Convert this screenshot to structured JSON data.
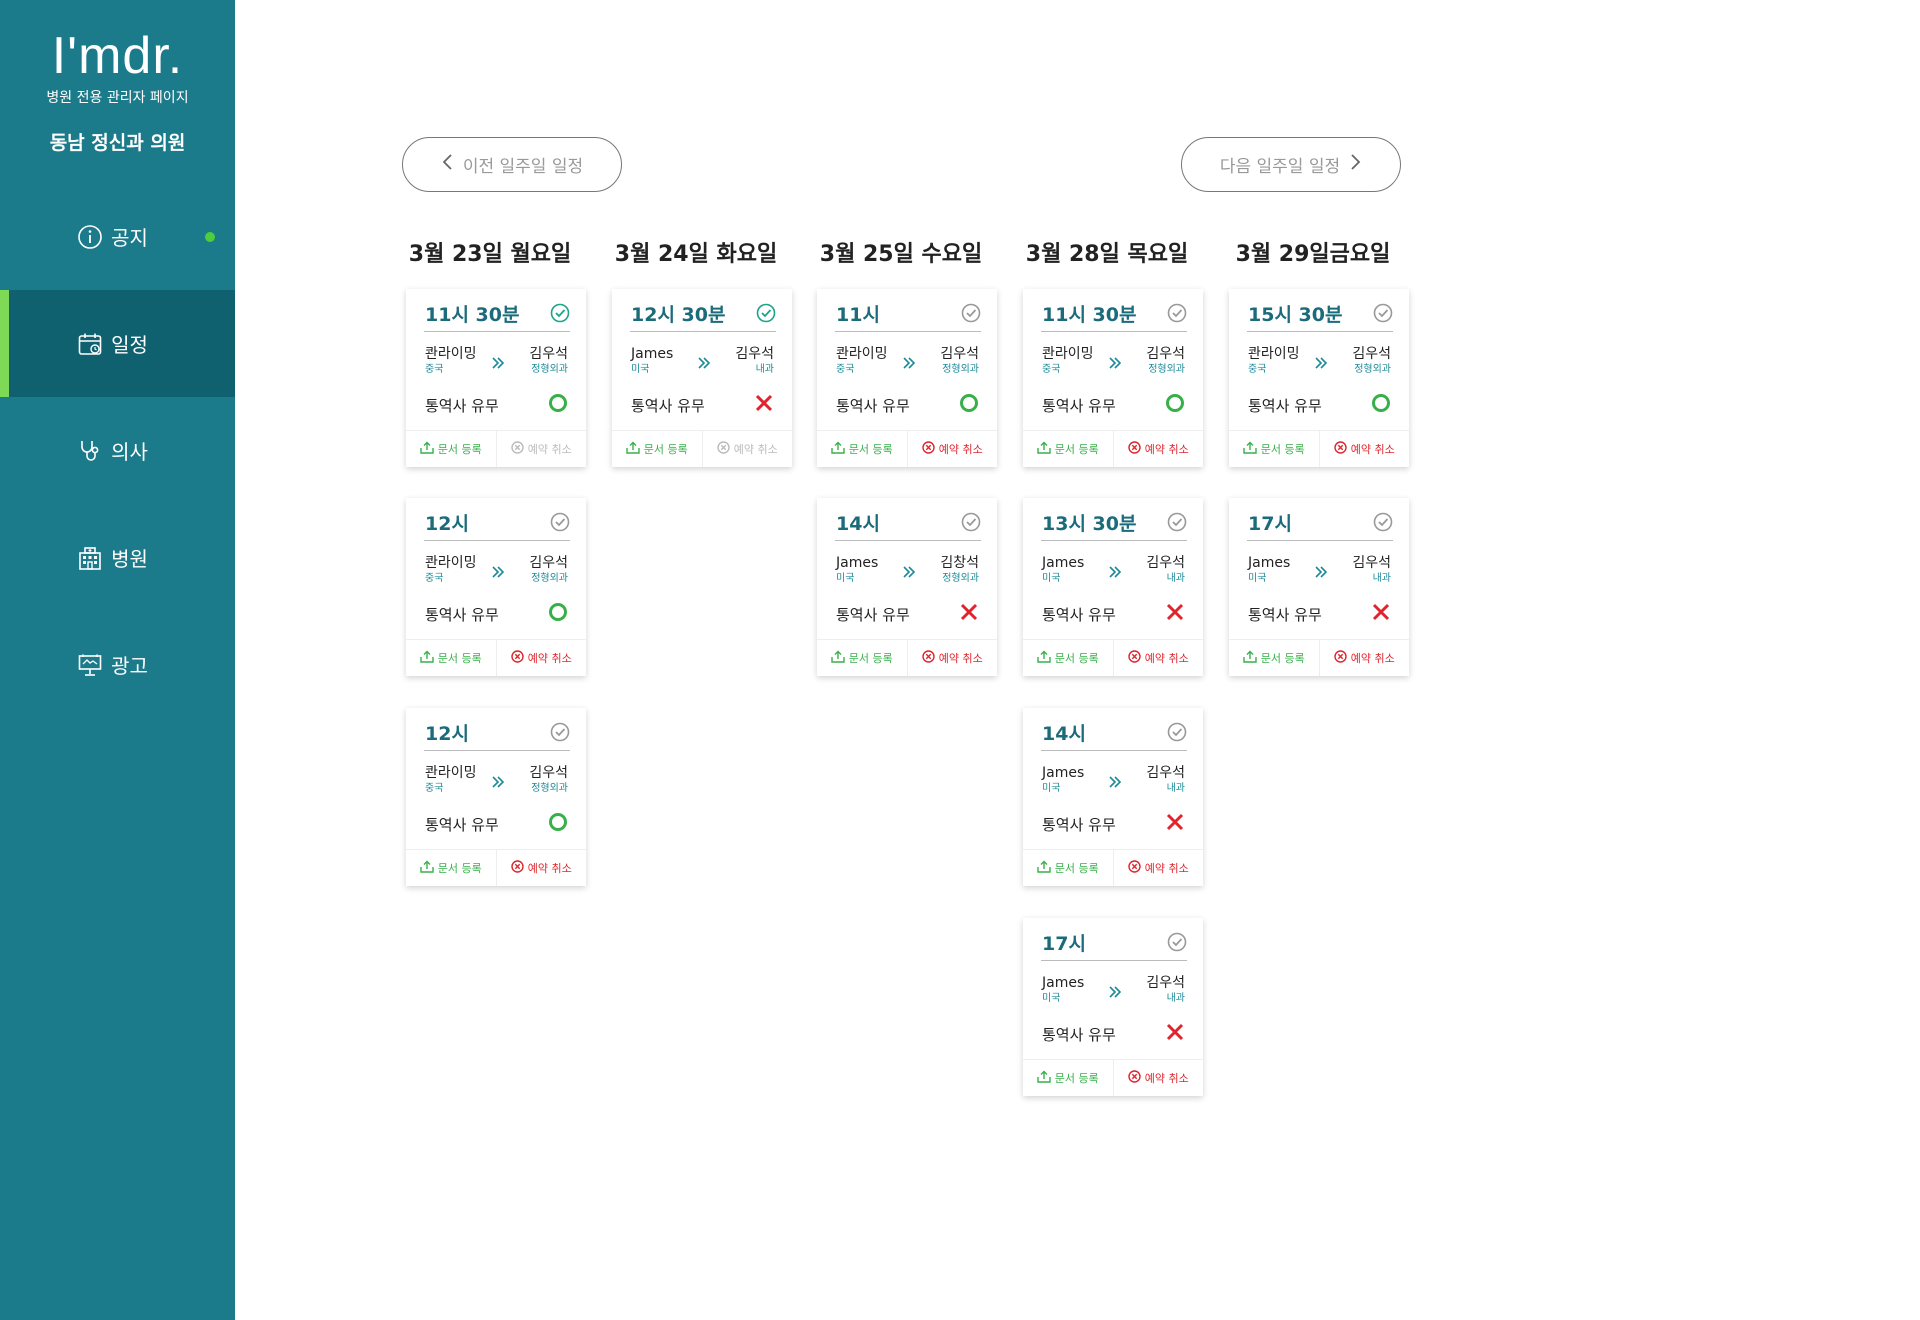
{
  "sidebar": {
    "logo": "I'mdr.",
    "subtitle": "병원 전용 관리자 페이지",
    "clinic_name": "동남 정신과 의원",
    "items": [
      {
        "label": "공지",
        "icon": "info-icon"
      },
      {
        "label": "일정",
        "icon": "calendar-icon"
      },
      {
        "label": "의사",
        "icon": "stethoscope-icon"
      },
      {
        "label": "병원",
        "icon": "hospital-icon"
      },
      {
        "label": "광고",
        "icon": "billboard-icon"
      }
    ],
    "active_item": "일정"
  },
  "week_nav": {
    "prev_label": "이전 일주일 일정",
    "next_label": "다음 일주일 일정"
  },
  "labels": {
    "interpreter": "통역사 유무",
    "upload": "문서 등록",
    "cancel": "예약 취소"
  },
  "days": [
    {
      "header": "3월 23일 월요일",
      "appointments": [
        {
          "time": "11시 30분",
          "confirmed": true,
          "patient": "콴라이밍",
          "country": "중국",
          "doctor": "김우석",
          "dept": "정형외과",
          "interpreter": true,
          "cancel_enabled": false
        },
        {
          "time": "12시",
          "confirmed": false,
          "patient": "콴라이밍",
          "country": "중국",
          "doctor": "김우석",
          "dept": "정형외과",
          "interpreter": true,
          "cancel_enabled": true
        },
        {
          "time": "12시",
          "confirmed": false,
          "patient": "콴라이밍",
          "country": "중국",
          "doctor": "김우석",
          "dept": "정형외과",
          "interpreter": true,
          "cancel_enabled": true
        }
      ]
    },
    {
      "header": "3월 24일 화요일",
      "appointments": [
        {
          "time": "12시 30분",
          "confirmed": true,
          "patient": "James",
          "country": "미국",
          "doctor": "김우석",
          "dept": "내과",
          "interpreter": false,
          "cancel_enabled": false
        }
      ]
    },
    {
      "header": "3월 25일 수요일",
      "appointments": [
        {
          "time": "11시",
          "confirmed": false,
          "patient": "콴라이밍",
          "country": "중국",
          "doctor": "김우석",
          "dept": "정형외과",
          "interpreter": true,
          "cancel_enabled": true
        },
        {
          "time": "14시",
          "confirmed": false,
          "patient": "James",
          "country": "미국",
          "doctor": "김창석",
          "dept": "정형외과",
          "interpreter": false,
          "cancel_enabled": true
        }
      ]
    },
    {
      "header": "3월 28일 목요일",
      "appointments": [
        {
          "time": "11시 30분",
          "confirmed": false,
          "patient": "콴라이밍",
          "country": "중국",
          "doctor": "김우석",
          "dept": "정형외과",
          "interpreter": true,
          "cancel_enabled": true
        },
        {
          "time": "13시 30분",
          "confirmed": false,
          "patient": "James",
          "country": "미국",
          "doctor": "김우석",
          "dept": "내과",
          "interpreter": false,
          "cancel_enabled": true
        },
        {
          "time": "14시",
          "confirmed": false,
          "patient": "James",
          "country": "미국",
          "doctor": "김우석",
          "dept": "내과",
          "interpreter": false,
          "cancel_enabled": true
        },
        {
          "time": "17시",
          "confirmed": false,
          "patient": "James",
          "country": "미국",
          "doctor": "김우석",
          "dept": "내과",
          "interpreter": false,
          "cancel_enabled": true
        }
      ]
    },
    {
      "header": "3월 29일금요일",
      "appointments": [
        {
          "time": "15시 30분",
          "confirmed": false,
          "patient": "콴라이밍",
          "country": "중국",
          "doctor": "김우석",
          "dept": "정형외과",
          "interpreter": true,
          "cancel_enabled": true
        },
        {
          "time": "17시",
          "confirmed": false,
          "patient": "James",
          "country": "미국",
          "doctor": "김우석",
          "dept": "내과",
          "interpreter": false,
          "cancel_enabled": true
        }
      ]
    }
  ],
  "colors": {
    "sidebar_bg": "#1c7b8a",
    "sidebar_active": "#10616f",
    "active_indicator": "#7ed957",
    "accent_teal": "#1b6b7b",
    "ok_green": "#38b04a",
    "cancel_red": "#e0242d"
  }
}
